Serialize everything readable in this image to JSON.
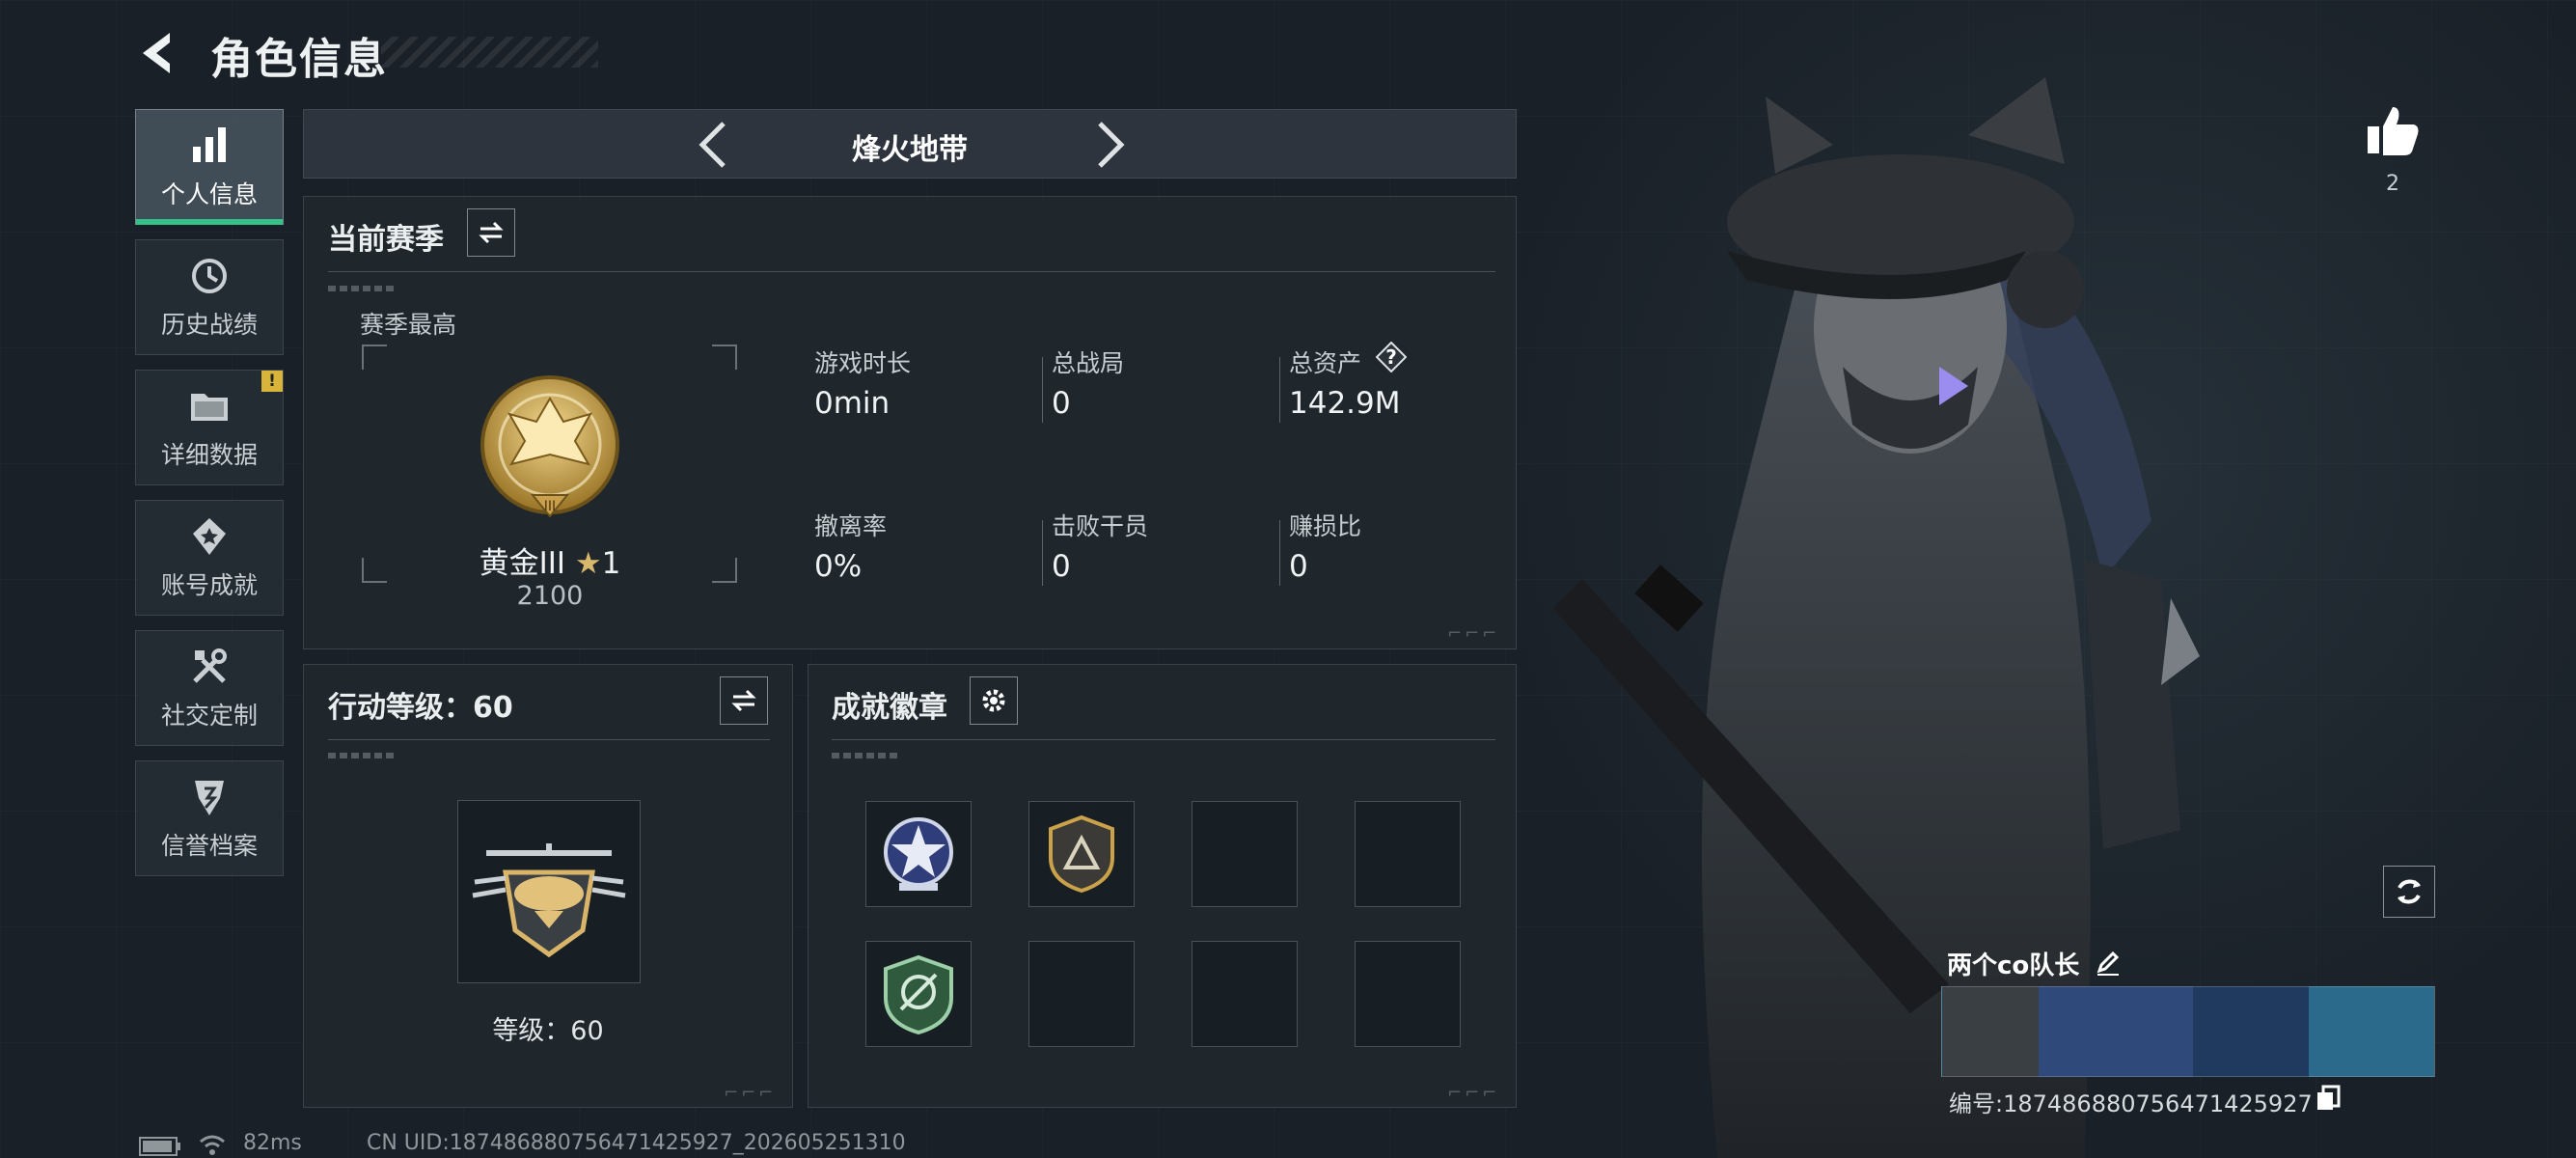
{
  "header": {
    "title": "角色信息"
  },
  "sidebar": {
    "items": [
      {
        "label": "个人信息",
        "icon": "bar-chart-icon",
        "active": true,
        "alert": false
      },
      {
        "label": "历史战绩",
        "icon": "history-icon",
        "active": false,
        "alert": false
      },
      {
        "label": "详细数据",
        "icon": "folder-icon",
        "active": false,
        "alert": true
      },
      {
        "label": "账号成就",
        "icon": "achievement-icon",
        "active": false,
        "alert": false
      },
      {
        "label": "社交定制",
        "icon": "tools-icon",
        "active": false,
        "alert": false
      },
      {
        "label": "信誉档案",
        "icon": "credit-icon",
        "active": false,
        "alert": false
      }
    ],
    "alert_mark": "!"
  },
  "mode": {
    "name": "烽火地带"
  },
  "season": {
    "title": "当前赛季",
    "best_label": "赛季最高",
    "rank_name": "黄金III",
    "rank_stars": "1",
    "rank_score": "2100",
    "stats": [
      {
        "label": "游戏时长",
        "value": "0min"
      },
      {
        "label": "总战局",
        "value": "0"
      },
      {
        "label": "总资产",
        "value": "142.9M"
      },
      {
        "label": "撤离率",
        "value": "0%"
      },
      {
        "label": "击败干员",
        "value": "0"
      },
      {
        "label": "赚损比",
        "value": "0"
      }
    ],
    "help_mark": "?"
  },
  "action_level": {
    "title": "行动等级：60",
    "level_text": "等级：60"
  },
  "achievements": {
    "title": "成就徽章",
    "slots": [
      "star-badge",
      "triangle-badge",
      "empty",
      "empty",
      "shield-badge",
      "empty",
      "empty",
      "empty"
    ]
  },
  "profile": {
    "likes": "2",
    "player_name": "两个co队长",
    "player_id": "编号:1874868807564714259​27"
  },
  "footer": {
    "ping": "82ms",
    "uid": "CN UID:1874868807564714259​27_202605251310"
  },
  "colors": {
    "accent_green": "#35c28a",
    "alert_yellow": "#d8b43a",
    "gold": "#c9a24a"
  }
}
